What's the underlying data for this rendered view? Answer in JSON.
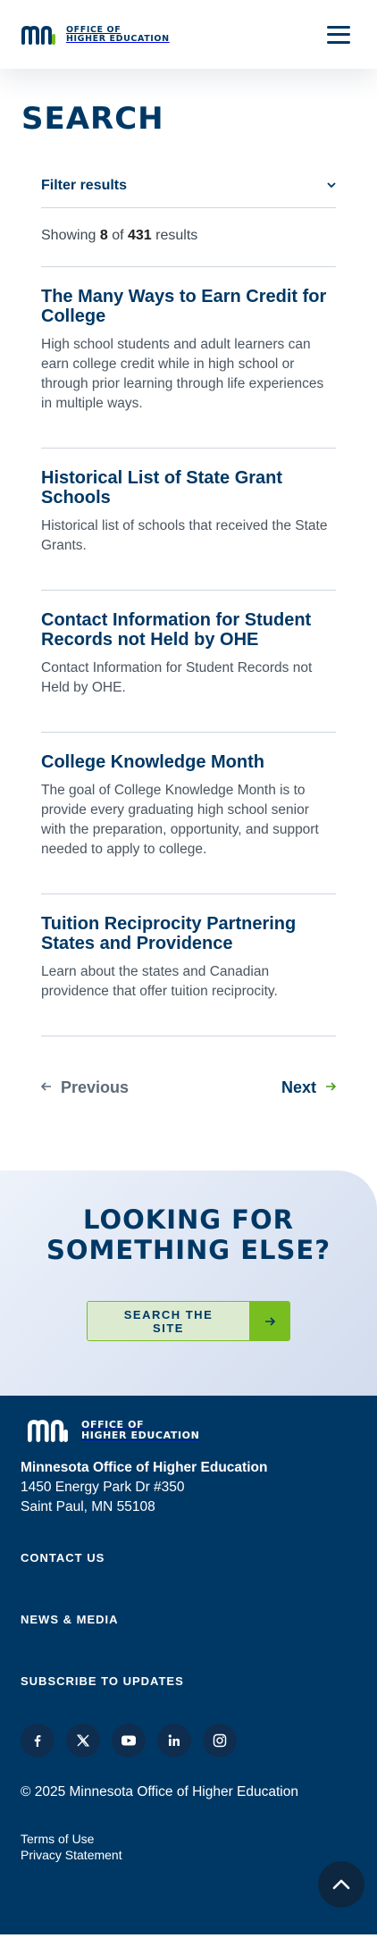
{
  "header": {
    "logo_line1": "OFFICE OF",
    "logo_line2": "HIGHER EDUCATION",
    "menu_icon": "hamburger-menu-icon"
  },
  "page_title": "SEARCH",
  "filter": {
    "label": "Filter results",
    "icon": "chevron-down-icon"
  },
  "summary": {
    "prefix": "Showing",
    "count": "8",
    "of": "of",
    "total": "431",
    "suffix": "results"
  },
  "results": [
    {
      "title": "The Many Ways to Earn Credit for College",
      "description": "High school students and adult learners can earn college credit while in high school or through prior learning through life experiences in multiple ways."
    },
    {
      "title": "Historical List of State Grant Schools",
      "description": "Historical list of schools that received the State Grants."
    },
    {
      "title": "Contact Information for Student Records not Held by OHE",
      "description": "Contact Information for Student Records not Held by OHE."
    },
    {
      "title": "College Knowledge Month",
      "description": "The goal of College Knowledge Month is to provide every graduating high school senior with the preparation, opportunity, and support needed to apply to college."
    },
    {
      "title": "Tuition Reciprocity Partnering States and Providence",
      "description": "Learn about the states and Canadian providence that offer tuition reciprocity."
    }
  ],
  "pagination": {
    "previous": "Previous",
    "next": "Next"
  },
  "cta": {
    "title_line1": "LOOKING FOR",
    "title_line2": "SOMETHING ELSE?",
    "button_label": "SEARCH THE SITE"
  },
  "footer": {
    "logo_line1": "OFFICE OF",
    "logo_line2": "HIGHER EDUCATION",
    "org_name": "Minnesota Office of Higher Education",
    "address_line1": "1450 Energy Park Dr #350",
    "address_line2": "Saint Paul, MN 55108",
    "links": [
      "CONTACT US",
      "NEWS & MEDIA",
      "SUBSCRIBE TO UPDATES"
    ],
    "social_icons": [
      "facebook-icon",
      "x-twitter-icon",
      "youtube-icon",
      "linkedin-icon",
      "instagram-icon"
    ],
    "copyright": "© 2025 Minnesota Office of Higher Education",
    "legal_links": [
      "Terms of Use",
      "Privacy Statement"
    ]
  },
  "colors": {
    "brand_navy": "#003865",
    "accent_green": "#78be20",
    "cta_bg": "#dee6f4"
  }
}
